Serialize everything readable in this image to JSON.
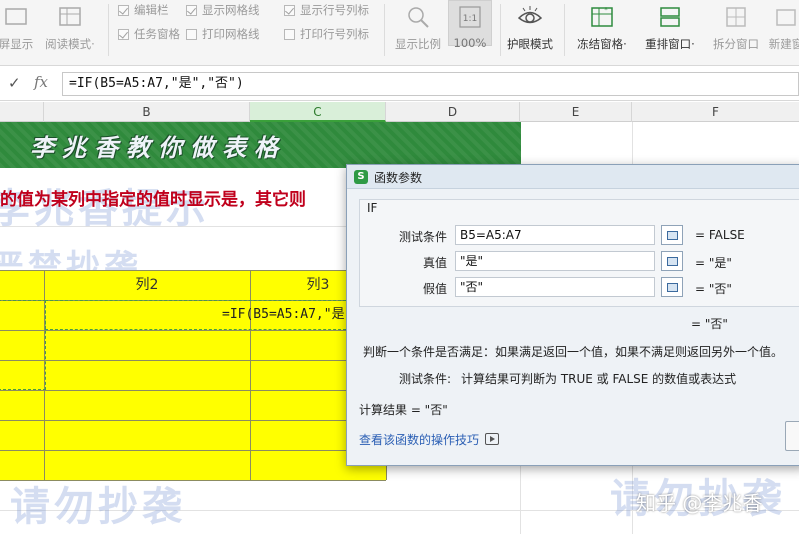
{
  "ribbon": {
    "left_buttons": [
      {
        "label": "屏显示",
        "icon": "fullscreen-icon"
      },
      {
        "label": "阅读模式·",
        "icon": "reading-mode-icon"
      }
    ],
    "checkboxes": [
      {
        "label": "编辑栏",
        "checked": true
      },
      {
        "label": "任务窗格",
        "checked": false
      },
      {
        "label": "显示网格线",
        "checked": true
      },
      {
        "label": "打印网格线",
        "checked": false
      },
      {
        "label": "显示行号列标",
        "checked": true
      },
      {
        "label": "打印行号列标",
        "checked": false
      }
    ],
    "right_buttons": [
      {
        "label": "显示比例",
        "icon": "zoom-icon"
      },
      {
        "label": "100%",
        "icon": "zoom-100-icon",
        "badge": "1:1"
      },
      {
        "label": "护眼模式",
        "icon": "eye-icon"
      },
      {
        "label": "冻结窗格·",
        "icon": "freeze-panes-icon"
      },
      {
        "label": "重排窗口·",
        "icon": "arrange-windows-icon"
      },
      {
        "label": "拆分窗口",
        "icon": "split-window-icon"
      },
      {
        "label": "新建窗",
        "icon": "new-window-icon"
      }
    ]
  },
  "formula_bar": {
    "fx": "fx",
    "value": "=IF(B5=A5:A7,\"是\",\"否\")"
  },
  "columns": [
    "B",
    "C",
    "D",
    "E",
    "F"
  ],
  "sheet": {
    "banner": "李兆香教你做表格",
    "note": "的值为某列中指定的值时显示是，其它则",
    "watermarks": [
      "李兆香提示",
      "严禁抄袭",
      "请勿抄袭",
      "请勿抄袭"
    ],
    "headers": [
      "列2",
      "列3"
    ],
    "cell_formula": "=IF(B5=A5:A7,\"是"
  },
  "dialog": {
    "title": "函数参数",
    "function_name": "IF",
    "args": [
      {
        "label": "测试条件",
        "value": "B5=A5:A7",
        "result": "= FALSE"
      },
      {
        "label": "真值",
        "value": "\"是\"",
        "result": "= \"是\""
      },
      {
        "label": "假值",
        "value": "\"否\"",
        "result": "= \"否\""
      }
    ],
    "overall_result": "= \"否\"",
    "description": "判断一个条件是否满足：如果满足返回一个值，如果不满足则返回另外一个值。",
    "param_desc_label": "测试条件:",
    "param_desc": "计算结果可判断为 TRUE 或 FALSE 的数值或表达式",
    "calc_result": "计算结果 = \"否\"",
    "help_link": "查看该函数的操作技巧",
    "logo": "S"
  },
  "overlay": {
    "zhihu": "知乎 @李兆香"
  }
}
